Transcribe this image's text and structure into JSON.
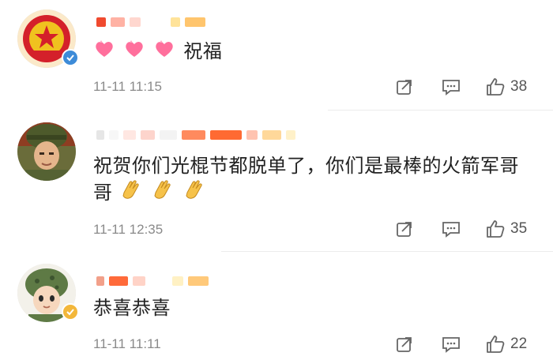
{
  "comments": [
    {
      "text_suffix": "祝福",
      "time": "11-11 11:15",
      "likes": "38",
      "badge_color": "#3d8bd8"
    },
    {
      "text_line1": "祝贺你们光棍节都脱单了，你们是最棒的火箭军哥",
      "text_line2": "哥",
      "time": "11-11 12:35",
      "likes": "35"
    },
    {
      "text": "恭喜恭喜",
      "time": "11-11 11:11",
      "likes": "22",
      "badge_color": "#f3b73a"
    }
  ],
  "icons": {
    "share": "share-icon",
    "comment": "comment-icon",
    "like": "thumbs-up-icon",
    "heart": "heart-emoji-icon",
    "clap": "clap-emoji-icon"
  }
}
